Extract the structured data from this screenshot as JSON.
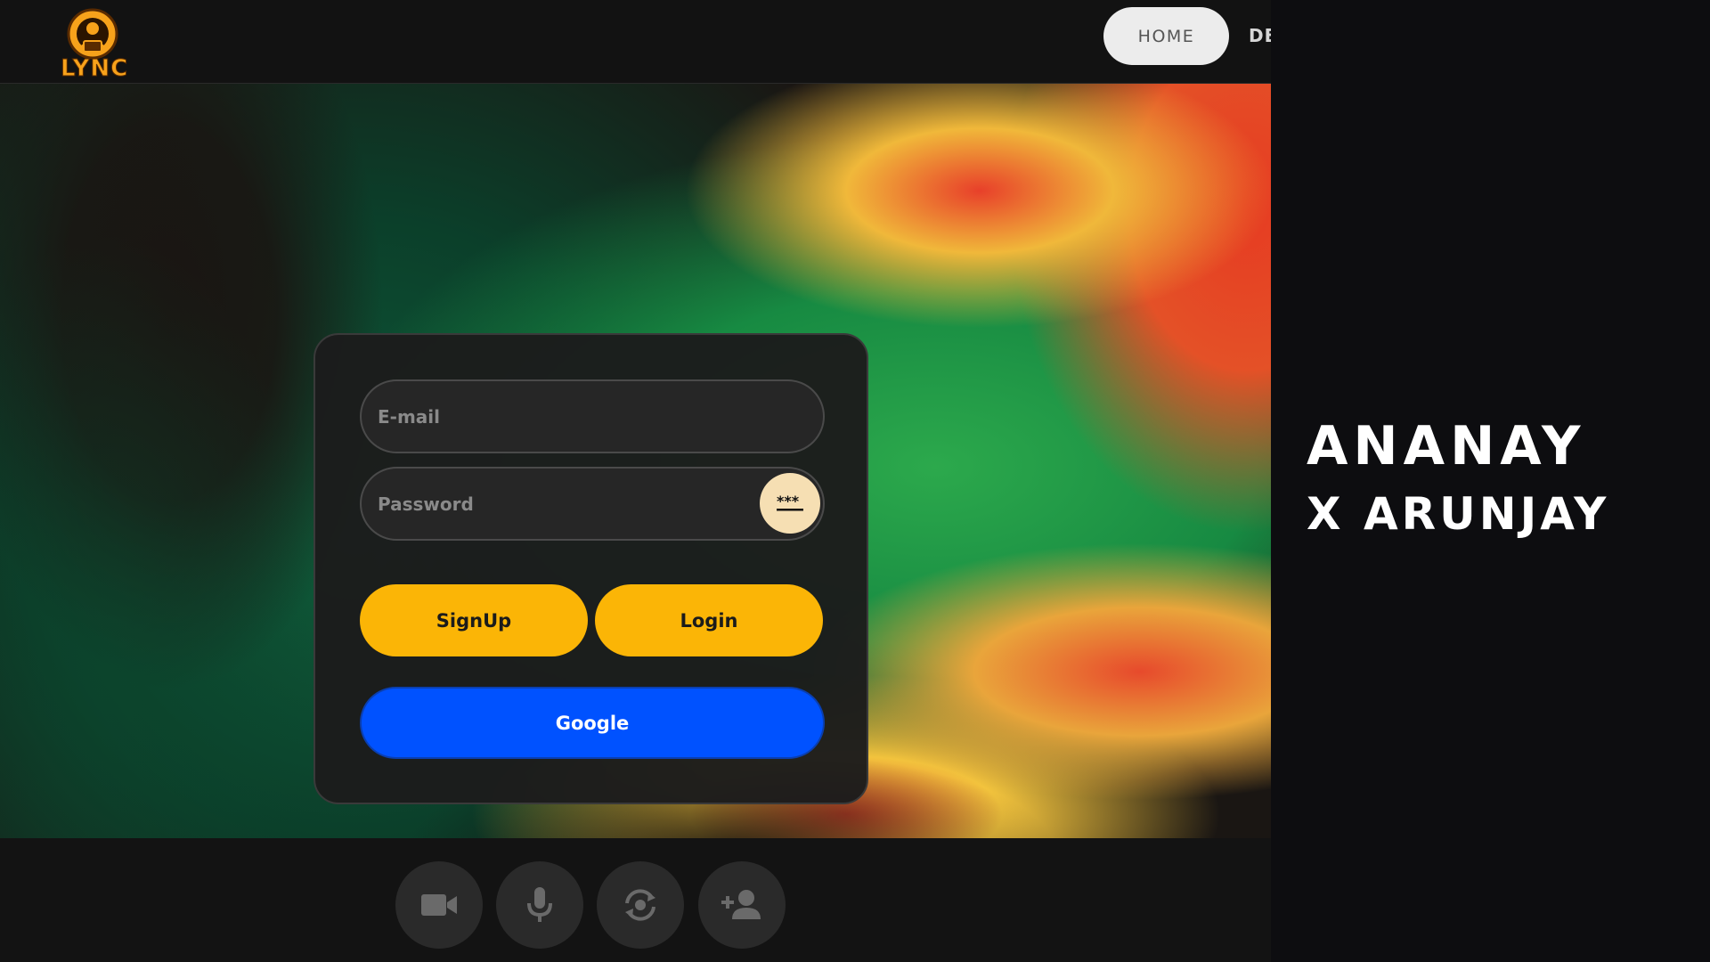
{
  "header": {
    "logo_text": "LYNC",
    "nav": [
      {
        "label": "HOME"
      },
      {
        "label": "DE"
      }
    ]
  },
  "auth_form": {
    "email_placeholder": "E-mail",
    "password_placeholder": "Password",
    "password_toggle_icon": "password-dots-icon",
    "signup_label": "SignUp",
    "login_label": "Login",
    "google_label": "Google"
  },
  "controls": [
    {
      "name": "camera",
      "icon": "video-camera-icon"
    },
    {
      "name": "microphone",
      "icon": "microphone-icon"
    },
    {
      "name": "switch-camera",
      "icon": "camera-switch-icon"
    },
    {
      "name": "add-person",
      "icon": "add-person-icon"
    }
  ],
  "credit": {
    "line1": "ANANAY",
    "line2": "X ARUNJAY"
  },
  "colors": {
    "accent_yellow": "#fbb506",
    "google_blue": "#0052ff",
    "logo_orange": "#f7a21b",
    "card_bg": "#1c1c1c"
  }
}
